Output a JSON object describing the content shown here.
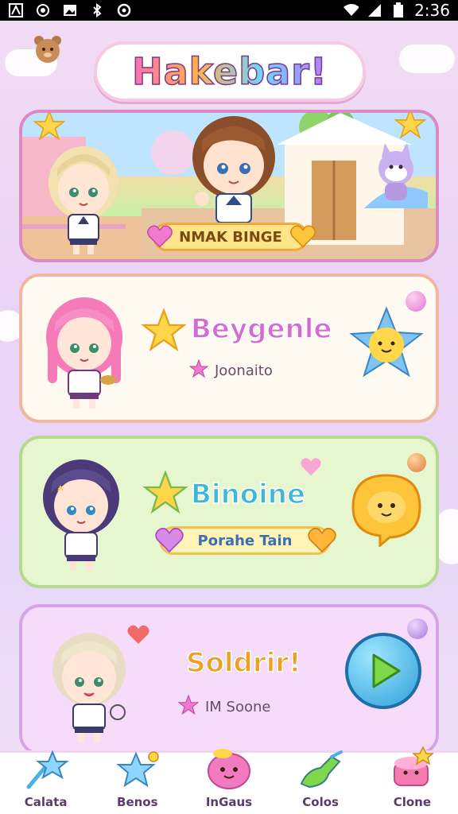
{
  "status_bar": {
    "time": "2:36",
    "icons": [
      "notification-icon",
      "sync-icon",
      "image-icon",
      "bluetooth-icon",
      "settings-icon",
      "wifi-icon",
      "signal-icon",
      "battery-icon"
    ]
  },
  "header": {
    "title": "Hakebar!"
  },
  "banner": {
    "label": "NMAK BINGE"
  },
  "cards": [
    {
      "title": "Beygenle",
      "subtitle": "Joonaito",
      "title_color": "#d46bd0"
    },
    {
      "title": "Binoine",
      "pill": "Porahe Tain",
      "title_color": "#3db7d6"
    },
    {
      "title": "Soldrir!",
      "subtitle": "IM Soone",
      "title_color": "#f0a020"
    }
  ],
  "bottom_nav": {
    "items": [
      {
        "label": "Calata",
        "icon": "star-wand-icon"
      },
      {
        "label": "Benos",
        "icon": "star-icon"
      },
      {
        "label": "InGaus",
        "icon": "blob-icon"
      },
      {
        "label": "Colos",
        "icon": "paintbrush-icon"
      },
      {
        "label": "Clone",
        "icon": "cake-icon"
      }
    ]
  }
}
